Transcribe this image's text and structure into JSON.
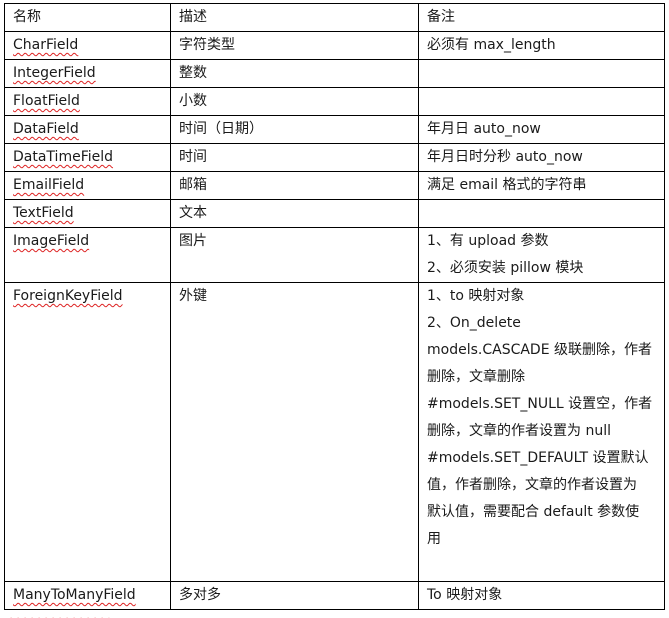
{
  "table": {
    "headers": [
      "名称",
      "描述",
      "备注"
    ],
    "rows": [
      {
        "name": "CharField",
        "desc": "字符类型",
        "note": [
          "必须有 max_length"
        ]
      },
      {
        "name": "IntegerField",
        "desc": "整数",
        "note": []
      },
      {
        "name": "FloatField",
        "desc": "小数",
        "note": []
      },
      {
        "name": "DataField",
        "desc": "时间（日期）",
        "note": [
          "年月日 auto_now"
        ]
      },
      {
        "name": "DataTimeField",
        "desc": "时间",
        "note": [
          "年月日时分秒 auto_now"
        ]
      },
      {
        "name": "EmailField",
        "desc": "邮箱",
        "note": [
          "满足 email 格式的字符串"
        ]
      },
      {
        "name": "TextField",
        "desc": "文本",
        "note": []
      },
      {
        "name": "ImageField",
        "desc": "图片",
        "note": [
          "1、有 upload 参数",
          "2、必须安装 pillow 模块"
        ]
      },
      {
        "name": "ForeignKeyField",
        "desc": "外键",
        "note": [
          "1、to 映射对象",
          "2、On_delete",
          "models.CASCADE 级联删除，作者",
          "删除，文章删除",
          "#models.SET_NULL 设置空，作者",
          "删除，文章的作者设置为 null",
          "#models.SET_DEFAULT 设置默认",
          "值，作者删除，文章的作者设置为",
          "默认值，需要配合 default 参数使",
          "用"
        ]
      },
      {
        "name": "ManyToManyField",
        "desc": "多对多",
        "note": [
          "To 映射对象"
        ]
      }
    ]
  }
}
